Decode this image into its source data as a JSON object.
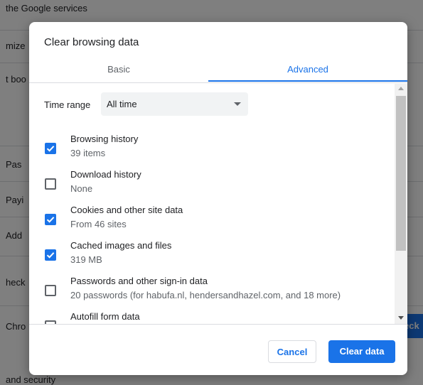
{
  "background": {
    "texts": [
      {
        "id": "bg-google-services",
        "text": "the Google services"
      },
      {
        "id": "bg-customize",
        "text": "mize"
      },
      {
        "id": "bg-bookmarks",
        "text": "t boo"
      },
      {
        "id": "bg-passwords",
        "text": "Pas"
      },
      {
        "id": "bg-payments",
        "text": "Payi"
      },
      {
        "id": "bg-addresses",
        "text": "Add"
      },
      {
        "id": "bg-check",
        "text": "heck"
      },
      {
        "id": "bg-chrome",
        "text": "Chro"
      },
      {
        "id": "bg-privacy",
        "text": "and security"
      }
    ],
    "check_button": "eck"
  },
  "dialog": {
    "title": "Clear browsing data",
    "tabs": [
      {
        "label": "Basic",
        "active": false
      },
      {
        "label": "Advanced",
        "active": true
      }
    ],
    "time_range": {
      "label": "Time range",
      "selected": "All time"
    },
    "options": [
      {
        "title": "Browsing history",
        "subtitle": "39 items",
        "checked": true
      },
      {
        "title": "Download history",
        "subtitle": "None",
        "checked": false
      },
      {
        "title": "Cookies and other site data",
        "subtitle": "From 46 sites",
        "checked": true
      },
      {
        "title": "Cached images and files",
        "subtitle": "319 MB",
        "checked": true
      },
      {
        "title": "Passwords and other sign-in data",
        "subtitle": "20 passwords (for habufa.nl, hendersandhazel.com, and 18 more)",
        "checked": false
      },
      {
        "title": "Autofill form data",
        "subtitle": "",
        "checked": false
      }
    ],
    "cancel_label": "Cancel",
    "clear_label": "Clear data"
  },
  "colors": {
    "accent": "#1a73e8",
    "scrim": "#000000"
  }
}
